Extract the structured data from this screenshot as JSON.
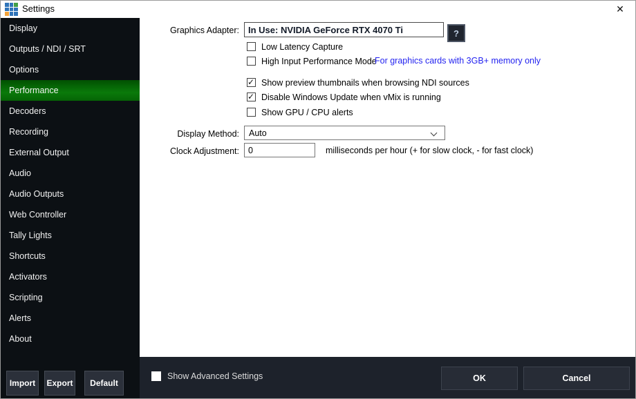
{
  "window": {
    "title": "Settings",
    "close_icon": "✕"
  },
  "sidebar": {
    "items": [
      {
        "label": "Display",
        "active": false
      },
      {
        "label": "Outputs / NDI / SRT",
        "active": false
      },
      {
        "label": "Options",
        "active": false
      },
      {
        "label": "Performance",
        "active": true
      },
      {
        "label": "Decoders",
        "active": false
      },
      {
        "label": "Recording",
        "active": false
      },
      {
        "label": "External Output",
        "active": false
      },
      {
        "label": "Audio",
        "active": false
      },
      {
        "label": "Audio Outputs",
        "active": false
      },
      {
        "label": "Web Controller",
        "active": false
      },
      {
        "label": "Tally Lights",
        "active": false
      },
      {
        "label": "Shortcuts",
        "active": false
      },
      {
        "label": "Activators",
        "active": false
      },
      {
        "label": "Scripting",
        "active": false
      },
      {
        "label": "Alerts",
        "active": false
      },
      {
        "label": "About",
        "active": false
      }
    ],
    "import_label": "Import",
    "export_label": "Export",
    "default_label": "Default"
  },
  "content": {
    "graphics_adapter": {
      "label": "Graphics Adapter:",
      "value": "In Use: NVIDIA GeForce RTX 4070 Ti",
      "help_label": "?"
    },
    "checkboxes": [
      {
        "label": "Low Latency Capture",
        "checked": false
      },
      {
        "label": "High Input Performance Mode",
        "checked": false
      },
      {
        "label": "Show preview thumbnails when browsing NDI sources",
        "checked": true
      },
      {
        "label": "Disable Windows Update when vMix is running",
        "checked": true
      },
      {
        "label": "Show GPU / CPU alerts",
        "checked": false
      }
    ],
    "high_input_note": "For graphics cards with 3GB+ memory only",
    "display_method": {
      "label": "Display Method:",
      "value": "Auto"
    },
    "clock_adjustment": {
      "label": "Clock Adjustment:",
      "value": "0",
      "suffix": "milliseconds per hour (+ for slow clock, - for fast clock)"
    }
  },
  "footer": {
    "advanced": {
      "label": "Show Advanced Settings",
      "checked": false
    },
    "ok_label": "OK",
    "cancel_label": "Cancel"
  },
  "colors": {
    "sidebar_bg": "#0c1014",
    "active_item_green": "#0a7a0a",
    "footer_bg": "#1d222b",
    "dark_button_bg": "#272c36",
    "note_blue": "#2323f0",
    "logo_blue": "#2f74b9",
    "logo_green": "#43a047",
    "logo_orange": "#f2a33c"
  }
}
